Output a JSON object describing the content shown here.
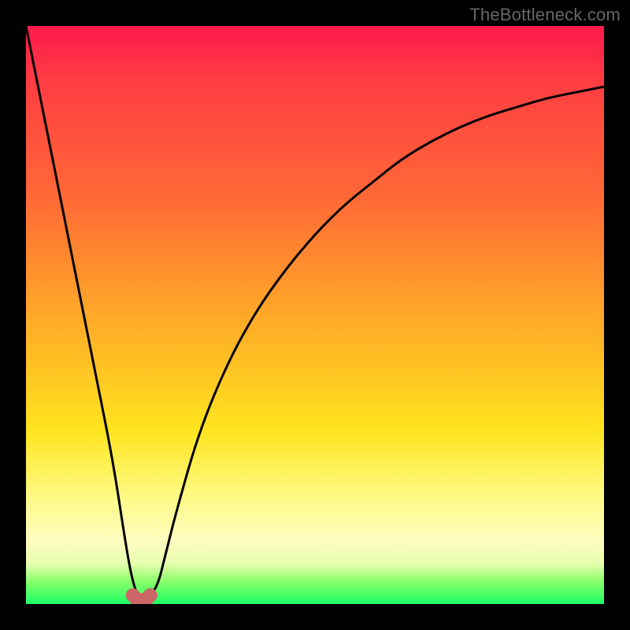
{
  "watermark": "TheBottleneck.com",
  "chart_data": {
    "type": "line",
    "title": "",
    "xlabel": "",
    "ylabel": "",
    "xlim": [
      0,
      100
    ],
    "ylim": [
      0,
      100
    ],
    "grid": false,
    "series": [
      {
        "name": "bottleneck-curve",
        "x": [
          0,
          3,
          6,
          9,
          12,
          15,
          17,
          18,
          19,
          20,
          21,
          22,
          23,
          24,
          26,
          30,
          35,
          40,
          45,
          50,
          55,
          60,
          65,
          70,
          75,
          80,
          85,
          90,
          95,
          100
        ],
        "values": [
          100,
          85,
          70,
          55,
          40,
          25,
          12,
          6,
          2,
          1,
          1,
          2,
          4,
          8,
          16,
          30,
          42,
          51,
          58,
          64,
          69,
          73,
          77,
          80,
          82.5,
          84.5,
          86,
          87.5,
          88.5,
          89.5
        ]
      }
    ],
    "markers": {
      "name": "valley-marker",
      "color": "#cc6666",
      "points": [
        {
          "x": 18.5,
          "y": 1.5
        },
        {
          "x": 19.0,
          "y": 1.0
        },
        {
          "x": 19.5,
          "y": 0.7
        },
        {
          "x": 20.0,
          "y": 0.6
        },
        {
          "x": 20.5,
          "y": 0.7
        },
        {
          "x": 21.0,
          "y": 1.0
        },
        {
          "x": 21.5,
          "y": 1.5
        }
      ]
    },
    "background_gradient": {
      "top": "#ff1a4d",
      "mid_upper": "#ff6a36",
      "mid": "#ffe41e",
      "mid_lower": "#fffcc0",
      "bottom": "#1bff66"
    }
  }
}
